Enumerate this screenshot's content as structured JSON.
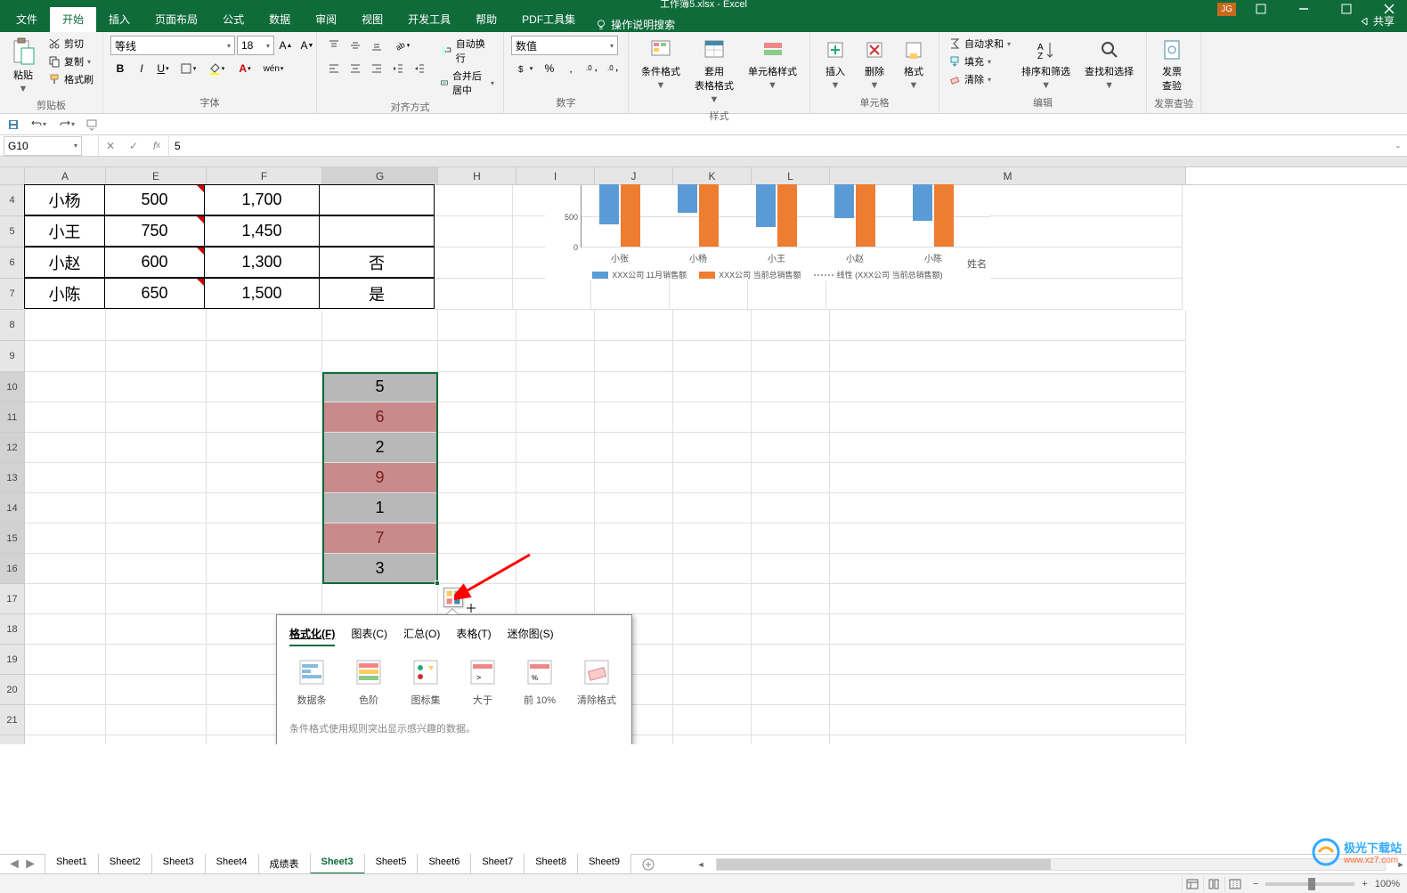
{
  "app": {
    "title": "工作簿5.xlsx - Excel"
  },
  "window": {
    "user_badge": "JG"
  },
  "menu": {
    "file": "文件",
    "tabs": [
      "开始",
      "插入",
      "页面布局",
      "公式",
      "数据",
      "审阅",
      "视图",
      "开发工具",
      "帮助",
      "PDF工具集"
    ],
    "active": "开始",
    "search_hint": "操作说明搜索",
    "share": "共享"
  },
  "ribbon": {
    "clipboard": {
      "label": "剪贴板",
      "paste": "粘贴",
      "cut": "剪切",
      "copy": "复制",
      "format_painter": "格式刷"
    },
    "font": {
      "label": "字体",
      "name": "等线",
      "size": "18"
    },
    "alignment": {
      "label": "对齐方式",
      "wrap": "自动换行",
      "merge": "合并后居中"
    },
    "number": {
      "label": "数字",
      "format": "数值"
    },
    "styles": {
      "label": "样式",
      "cond": "条件格式",
      "table": "套用\n表格格式",
      "cell": "单元格样式"
    },
    "cells": {
      "label": "单元格",
      "insert": "插入",
      "delete": "删除",
      "format": "格式"
    },
    "editing": {
      "label": "编辑",
      "autosum": "自动求和",
      "fill": "填充",
      "clear": "清除",
      "sort": "排序和筛选",
      "find": "查找和选择"
    },
    "invoice": {
      "label": "发票查验",
      "btn": "发票\n查验"
    }
  },
  "formula_bar": {
    "name_box": "G10",
    "value": "5"
  },
  "columns": [
    "A",
    "E",
    "F",
    "G",
    "H",
    "I",
    "J",
    "K",
    "L",
    "M"
  ],
  "table_rows": [
    {
      "r": 4,
      "a": "小杨",
      "e": "500",
      "f": "1,700",
      "g": ""
    },
    {
      "r": 5,
      "a": "小王",
      "e": "750",
      "f": "1,450",
      "g": ""
    },
    {
      "r": 6,
      "a": "小赵",
      "e": "600",
      "f": "1,300",
      "g": "否"
    },
    {
      "r": 7,
      "a": "小陈",
      "e": "650",
      "f": "1,500",
      "g": "是"
    }
  ],
  "cond_values": [
    {
      "v": "5",
      "red": false
    },
    {
      "v": "6",
      "red": true
    },
    {
      "v": "2",
      "red": false
    },
    {
      "v": "9",
      "red": true
    },
    {
      "v": "1",
      "red": false
    },
    {
      "v": "7",
      "red": true
    },
    {
      "v": "3",
      "red": false
    }
  ],
  "chart_data": {
    "type": "bar",
    "categories": [
      "小张",
      "小杨",
      "小王",
      "小陈",
      "小赵",
      "小陈"
    ],
    "x_display": [
      "小张",
      "小杨",
      "小王",
      "小赵",
      "小陈"
    ],
    "series": [
      {
        "name": "XXX公司 11月销售额",
        "values": [
          700,
          500,
          750,
          600,
          650
        ]
      },
      {
        "name": "XXX公司 当前总销售额",
        "values": [
          1100,
          1100,
          1100,
          1100,
          1100
        ]
      }
    ],
    "trendline": "线性 (XXX公司 当前总销售额)",
    "y_ticks": [
      0,
      500
    ],
    "axis_title": "姓名",
    "ylim": [
      0,
      1100
    ]
  },
  "quick_analysis": {
    "tabs": [
      "格式化(F)",
      "图表(C)",
      "汇总(O)",
      "表格(T)",
      "迷你图(S)"
    ],
    "active": 0,
    "options": [
      "数据条",
      "色阶",
      "图标集",
      "大于",
      "前 10%",
      "清除格式"
    ],
    "hint": "条件格式使用规则突出显示感兴趣的数据。"
  },
  "sheets": {
    "tabs": [
      "Sheet1",
      "Sheet2",
      "Sheet3",
      "Sheet4",
      "成绩表",
      "Sheet3",
      "Sheet5",
      "Sheet6",
      "Sheet7",
      "Sheet8",
      "Sheet9"
    ],
    "active": 5
  },
  "status": {
    "zoom": "100%"
  },
  "watermark": {
    "text": "极光下载站",
    "url": "www.xz7.com"
  }
}
